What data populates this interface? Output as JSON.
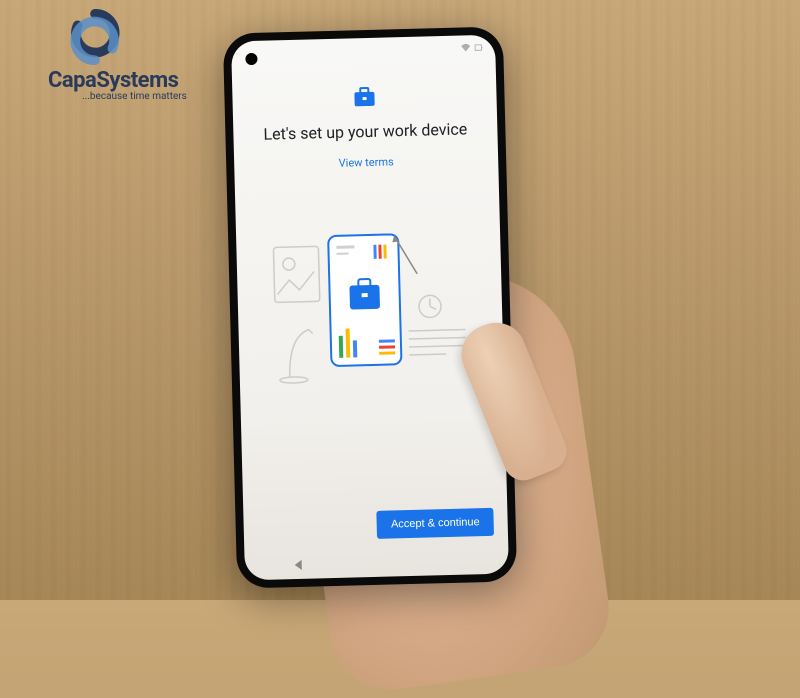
{
  "logo": {
    "name": "CapaSystems",
    "tagline": "...because time matters"
  },
  "screen": {
    "title": "Let's set up your work device",
    "terms_link": "View terms",
    "primary_button": "Accept & continue"
  },
  "colors": {
    "accent": "#1a73e8",
    "logo_primary": "#2a3a5a",
    "logo_accent": "#5b8fc7"
  }
}
